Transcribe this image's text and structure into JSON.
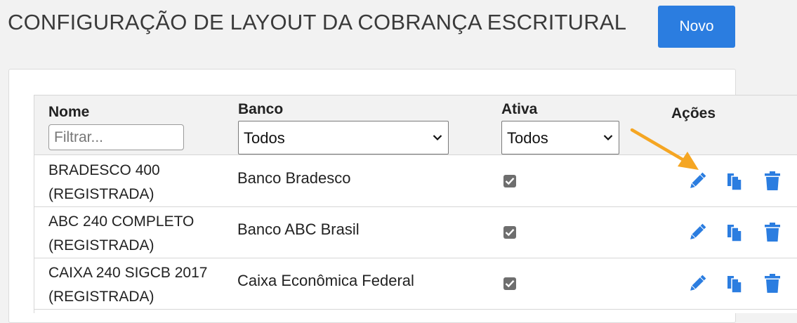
{
  "page": {
    "title": "CONFIGURAÇÃO DE LAYOUT DA COBRANÇA ESCRITURAL"
  },
  "toolbar": {
    "new_label": "Novo"
  },
  "table": {
    "headers": {
      "nome": "Nome",
      "banco": "Banco",
      "ativa": "Ativa",
      "acoes": "Ações"
    },
    "filters": {
      "nome_placeholder": "Filtrar...",
      "banco_selected": "Todos",
      "ativa_selected": "Todos"
    },
    "rows": [
      {
        "nome_line1": "BRADESCO 400",
        "nome_line2": "(REGISTRADA)",
        "banco": "Banco Bradesco",
        "ativa": true
      },
      {
        "nome_line1": "ABC 240 COMPLETO",
        "nome_line2": "(REGISTRADA)",
        "banco": "Banco ABC Brasil",
        "ativa": true
      },
      {
        "nome_line1": "CAIXA 240 SIGCB 2017",
        "nome_line2": "(REGISTRADA)",
        "banco": "Caixa Econômica Federal",
        "ativa": true
      }
    ],
    "row_actions": [
      "pencil-icon",
      "copy-icon",
      "trash-icon"
    ]
  },
  "colors": {
    "accent": "#2b7de0",
    "annotation_arrow": "#f5a623",
    "checkbox": "#6e6e6e"
  }
}
